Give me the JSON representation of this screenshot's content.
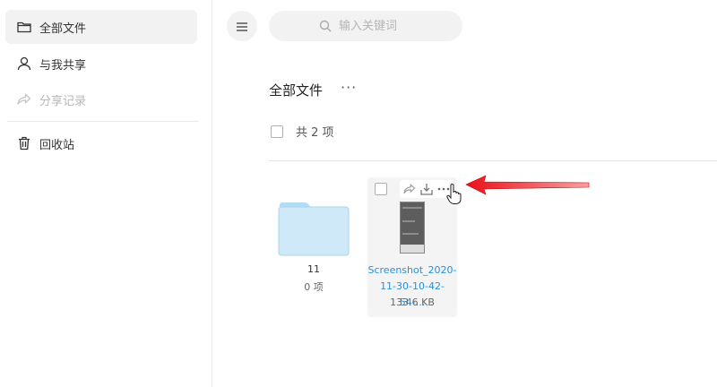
{
  "sidebar": {
    "items": [
      {
        "label": "全部文件",
        "icon": "folder-icon"
      },
      {
        "label": "与我共享",
        "icon": "user-icon"
      },
      {
        "label": "分享记录",
        "icon": "share-icon"
      },
      {
        "label": "回收站",
        "icon": "trash-icon"
      }
    ]
  },
  "toolbar": {
    "menu_icon": "hamburger-icon",
    "search": {
      "placeholder": "输入关键词"
    }
  },
  "header": {
    "title": "全部文件",
    "more": "···",
    "count_label": "共 2 项"
  },
  "items": [
    {
      "type": "folder",
      "name": "11",
      "meta": "0 项",
      "icon": "folder-icon"
    },
    {
      "type": "file",
      "name_line1": "Screenshot_2020-",
      "name_line2": "11-30-10-42-54-...",
      "size": "133.6 KB",
      "actions": [
        "share-icon",
        "download-icon",
        "more-icon"
      ]
    }
  ],
  "colors": {
    "accent": "#2a8fd6",
    "annotation_arrow": "#e8111a",
    "folder": "#cfe9f8"
  }
}
